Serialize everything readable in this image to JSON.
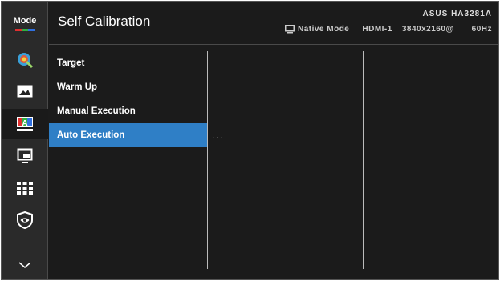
{
  "rail": {
    "mode_label": "Mode",
    "icons": [
      {
        "name": "color-icon"
      },
      {
        "name": "image-icon"
      },
      {
        "name": "color-picture-icon"
      },
      {
        "name": "pip-pbp-icon"
      },
      {
        "name": "shortcut-grid-icon"
      },
      {
        "name": "eye-care-icon"
      },
      {
        "name": "chevron-down-icon"
      }
    ]
  },
  "header": {
    "title": "Self Calibration",
    "model": "ASUS HA3281A",
    "status": {
      "mode": "Native Mode",
      "input": "HDMI-1",
      "resolution": "3840x2160@",
      "refresh": "60Hz"
    }
  },
  "menu": {
    "items": [
      {
        "label": "Target"
      },
      {
        "label": "Warm Up"
      },
      {
        "label": "Manual Execution"
      },
      {
        "label": "Auto Execution"
      }
    ],
    "selected_index": 3,
    "submenu_value": "..."
  },
  "colors": {
    "accent": "#2f7fc6",
    "background": "#1b1b1b"
  }
}
